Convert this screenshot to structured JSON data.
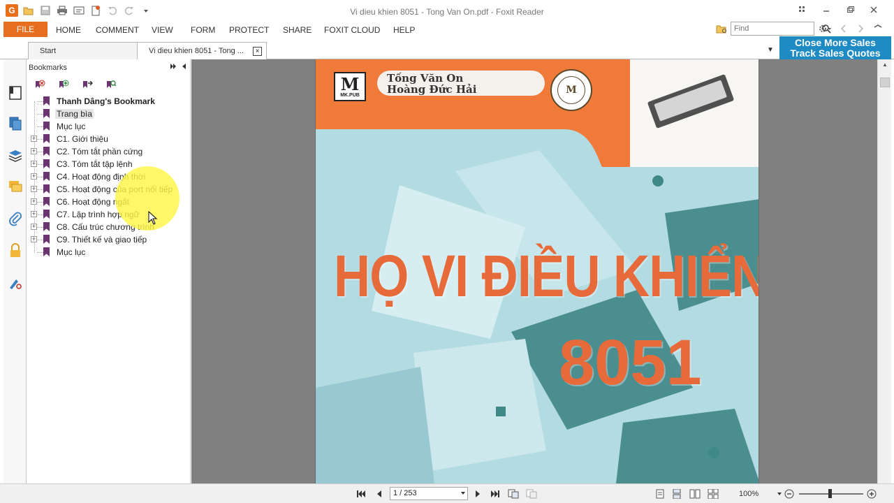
{
  "window": {
    "title": "Vi dieu khien 8051 - Tong Van On.pdf - Foxit Reader",
    "controls": [
      "minimize",
      "restore",
      "close"
    ]
  },
  "menu": {
    "file": "FILE",
    "items": [
      "HOME",
      "COMMENT",
      "VIEW",
      "FORM",
      "PROTECT",
      "SHARE",
      "FOXIT CLOUD",
      "HELP"
    ]
  },
  "find": {
    "placeholder": "Find"
  },
  "tabs": {
    "start": "Start",
    "document": "Vi dieu khien 8051 - Tong ..."
  },
  "ad": {
    "line1": "Close More Sales",
    "line2": "Track Sales Quotes"
  },
  "bookmarks": {
    "header": "Bookmarks",
    "items": [
      {
        "label": "Thanh Dâng's Bookmark",
        "expandable": false
      },
      {
        "label": "Trang bìa",
        "expandable": false
      },
      {
        "label": "Mục lục",
        "expandable": false
      },
      {
        "label": "C1. Giới thiệu",
        "expandable": true
      },
      {
        "label": "C2. Tóm tắt phần cứng",
        "expandable": true
      },
      {
        "label": "C3. Tóm tắt tập lệnh",
        "expandable": true
      },
      {
        "label": "C4. Hoạt động định thời",
        "expandable": true
      },
      {
        "label": "C5. Hoạt động của port nối tiếp",
        "expandable": true
      },
      {
        "label": "C6. Hoạt động ngắt",
        "expandable": true
      },
      {
        "label": "C7. Lập trình hợp ngữ",
        "expandable": true
      },
      {
        "label": "C8. Cấu trúc chương trình",
        "expandable": true
      },
      {
        "label": "C9. Thiết kế và giao tiếp",
        "expandable": true
      },
      {
        "label": "Mục lục",
        "expandable": false
      }
    ]
  },
  "page": {
    "publisher_logo": "M",
    "publisher_text": "MK.PUB",
    "author1": "Tống Văn On",
    "author2": "Hoàng Đức Hải",
    "title": "HỌ VI ĐIỀU KHIỂN",
    "number": "8051"
  },
  "status": {
    "page_indicator": "1 / 253",
    "zoom": "100%"
  },
  "colors": {
    "file_button": "#e56e1f",
    "cover_orange": "#f07a3a",
    "cover_teal": "#a8d2da",
    "title_orange": "#e66a3a",
    "ad_blue": "#1f8bc4",
    "bookmark_flag": "#6c3470"
  }
}
